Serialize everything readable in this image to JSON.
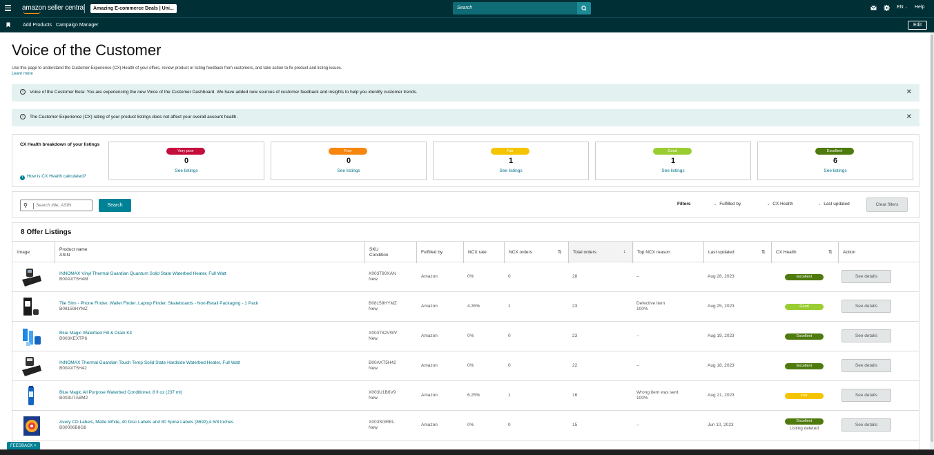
{
  "topbar": {
    "logo_text": "amazon seller central",
    "store_name": "Amazing E-commerce Deals | Uni...",
    "search_placeholder": "Search",
    "language": "EN",
    "help": "Help"
  },
  "nav": {
    "links": [
      "Add Products",
      "Campaign Manager"
    ],
    "edit": "Edit"
  },
  "page": {
    "title": "Voice of the Customer",
    "description": "Use this page to understand the Customer Experience (CX) Health of your offers, review product or listing feedback from customers, and take action to fix product and listing issues.",
    "learn_more": "Learn more"
  },
  "banners": [
    {
      "text": "Voice of the Customer Beta: You are experiencing the new Voice of the Customer Dashboard. We have added new sources of customer feedback and insights to help you identify customer trends."
    },
    {
      "text": "The Customer Experience (CX) rating of your product listings does not affect your overall account health."
    }
  ],
  "cx_health": {
    "title": "CX Health breakdown of your listings",
    "how_link": "How is CX Health calculated?",
    "cards": [
      {
        "label": "Very poor",
        "count": "0",
        "link": "See listings",
        "color": "#c40e3c"
      },
      {
        "label": "Poor",
        "count": "0",
        "link": "See listings",
        "color": "#f7860f"
      },
      {
        "label": "Fair",
        "count": "1",
        "link": "See listings",
        "color": "#f5c400"
      },
      {
        "label": "Good",
        "count": "1",
        "link": "See listings",
        "color": "#9acd32"
      },
      {
        "label": "Excellent",
        "count": "6",
        "link": "See listings",
        "color": "#4e7a0e"
      }
    ]
  },
  "filters": {
    "search_placeholder": "Search title, ASIN",
    "search_button": "Search",
    "label": "Filters",
    "fulfilled_by": "Fulfilled by",
    "cx_health": "CX Health",
    "last_updated": "Last updated",
    "clear": "Clear filters"
  },
  "table": {
    "title": "8 Offer Listings",
    "headers": {
      "image": "Image",
      "product_name": "Product name",
      "asin": "ASIN",
      "sku": "SKU",
      "condition": "Condition",
      "fulfilled_by": "Fulfilled by",
      "ncx_rate": "NCX rate",
      "ncx_orders": "NCX orders",
      "total_orders": "Total orders",
      "top_ncx_reason": "Top NCX reason",
      "last_updated": "Last updated",
      "cx_health": "CX Health",
      "action": "Action"
    },
    "rows": [
      {
        "name": "INNOMAX Vinyl Thermal Guardian Quantum Solid State Waterbed Heater, Full Watt",
        "asin": "B00AXT5H4M",
        "sku": "X003T80XAN",
        "condition": "New",
        "fulfilled": "Amazon",
        "ncx_rate": "0%",
        "ncx_orders": "0",
        "total": "28",
        "reason": "--",
        "reason_pct": "",
        "updated": "Aug 28, 2023",
        "health": "Excellent",
        "health_color": "#4e7a0e",
        "health_note": "",
        "action": "See details"
      },
      {
        "name": "Tile Slim - Phone Finder. Wallet Finder. Laptop Finder, Skateboards - Non-Retail Packaging - 1 Pack",
        "asin": "B08159HYMZ",
        "sku": "B08159HYMZ",
        "condition": "New",
        "fulfilled": "Amazon",
        "ncx_rate": "4.35%",
        "ncx_orders": "1",
        "total": "23",
        "reason": "Defective item",
        "reason_pct": "100%",
        "updated": "Aug 25, 2023",
        "health": "Good",
        "health_color": "#9acd32",
        "health_note": "",
        "action": "See details"
      },
      {
        "name": "Blue Magic Waterbed Fill & Drain Kit",
        "asin": "B003XEXTP6",
        "sku": "X003T82VWV",
        "condition": "New",
        "fulfilled": "Amazon",
        "ncx_rate": "0%",
        "ncx_orders": "0",
        "total": "23",
        "reason": "--",
        "reason_pct": "",
        "updated": "Aug 19, 2023",
        "health": "Excellent",
        "health_color": "#4e7a0e",
        "health_note": "",
        "action": "See details"
      },
      {
        "name": "INNOMAX Thermal Guardian Touch Temp Solid State Hardside Waterbed Heater, Full Watt",
        "asin": "B00AXT5H42",
        "sku": "B00AXT5H42",
        "condition": "New",
        "fulfilled": "Amazon",
        "ncx_rate": "0%",
        "ncx_orders": "0",
        "total": "22",
        "reason": "--",
        "reason_pct": "",
        "updated": "Aug 18, 2023",
        "health": "Excellent",
        "health_color": "#4e7a0e",
        "health_note": "",
        "action": "See details"
      },
      {
        "name": "Blue Magic All Purpose Waterbed Conditioner, 8 fl oz (237 ml)",
        "asin": "B003U7ABM2",
        "sku": "X003U1B6V9",
        "condition": "New",
        "fulfilled": "Amazon",
        "ncx_rate": "6.25%",
        "ncx_orders": "1",
        "total": "16",
        "reason": "Wrong item was sent",
        "reason_pct": "100%",
        "updated": "Aug 21, 2023",
        "health": "Fair",
        "health_color": "#f5c400",
        "health_note": "",
        "action": "See details"
      },
      {
        "name": "Avery CD Labels, Matte White, 40 Disc Labels and 80 Spine Labels (8692),4.5/8 Inches",
        "asin": "B00006B8G8",
        "sku": "X003S0IREL",
        "condition": "New",
        "fulfilled": "Amazon",
        "ncx_rate": "0%",
        "ncx_orders": "0",
        "total": "15",
        "reason": "--",
        "reason_pct": "",
        "updated": "Jun 10, 2023",
        "health": "Excellent",
        "health_color": "#4e7a0e",
        "health_note": "Listing deleted",
        "action": "See details"
      }
    ]
  },
  "feedback": "FEEDBACK ×"
}
